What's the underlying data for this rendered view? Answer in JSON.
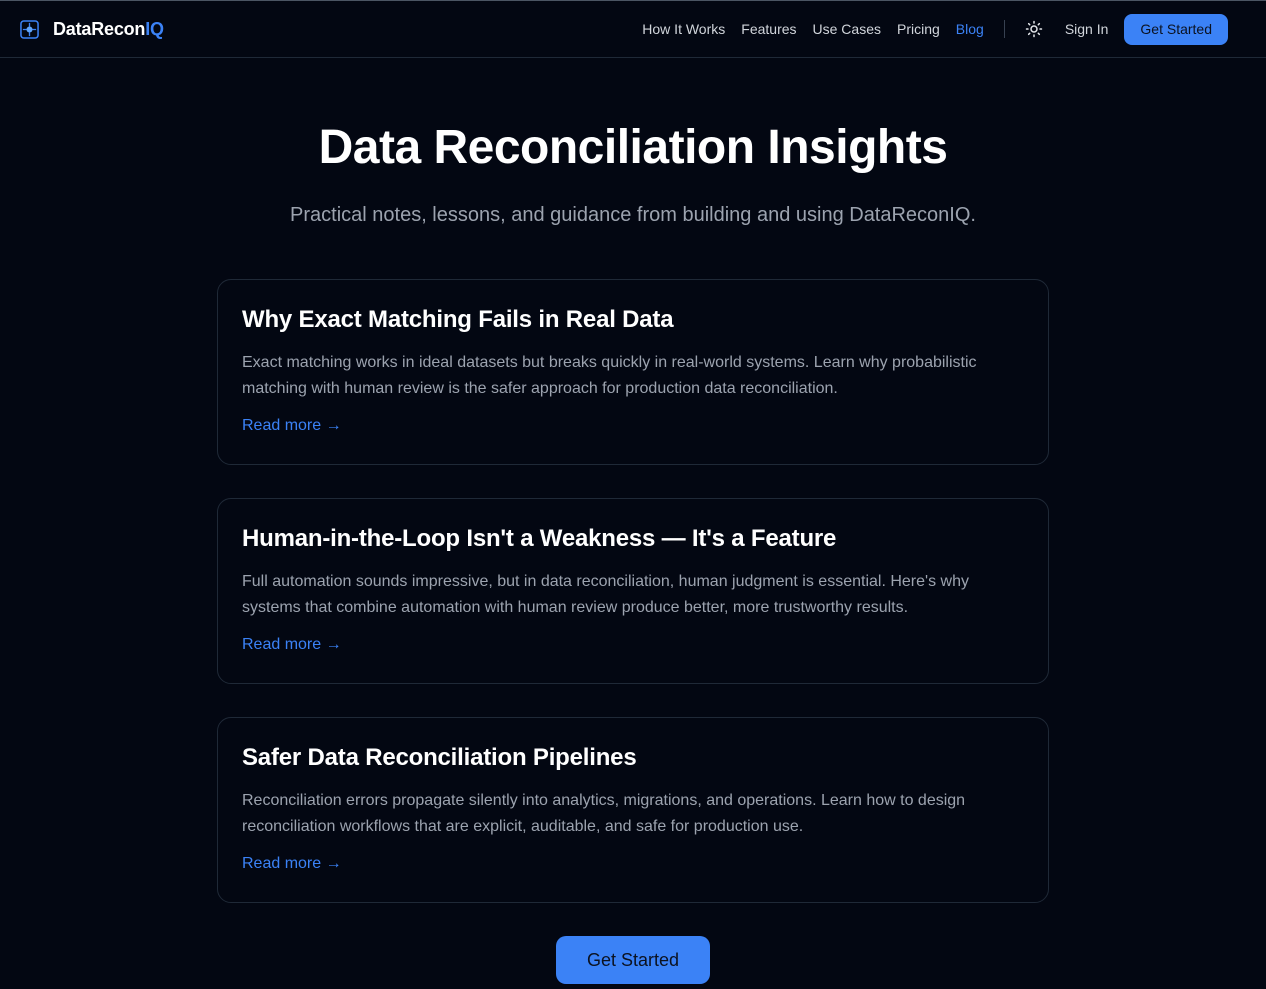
{
  "header": {
    "brand_main": "DataRecon",
    "brand_accent": "IQ",
    "nav": [
      "How It Works",
      "Features",
      "Use Cases",
      "Pricing",
      "Blog"
    ],
    "active_nav": "Blog",
    "theme_icon": "sun-icon",
    "sign_in": "Sign In",
    "get_started": "Get Started"
  },
  "hero": {
    "title": "Data Reconciliation Insights",
    "subtitle": "Practical notes, lessons, and guidance from building and using DataReconIQ."
  },
  "posts": [
    {
      "title": "Why Exact Matching Fails in Real Data",
      "excerpt": "Exact matching works in ideal datasets but breaks quickly in real-world systems. Learn why probabilistic matching with human review is the safer approach for production data reconciliation.",
      "read_more": "Read more →"
    },
    {
      "title": "Human-in-the-Loop Isn't a Weakness — It's a Feature",
      "excerpt": "Full automation sounds impressive, but in data reconciliation, human judgment is essential. Here's why systems that combine automation with human review produce better, more trustworthy results.",
      "read_more": "Read more →"
    },
    {
      "title": "Safer Data Reconciliation Pipelines",
      "excerpt": "Reconciliation errors propagate silently into analytics, migrations, and operations. Learn how to design reconciliation workflows that are explicit, auditable, and safe for production use.",
      "read_more": "Read more →"
    }
  ],
  "cta": {
    "label": "Get Started"
  },
  "colors": {
    "background": "#030712",
    "accent": "#3b82f6",
    "muted_text": "#9ca3af",
    "border": "#1f2937"
  }
}
